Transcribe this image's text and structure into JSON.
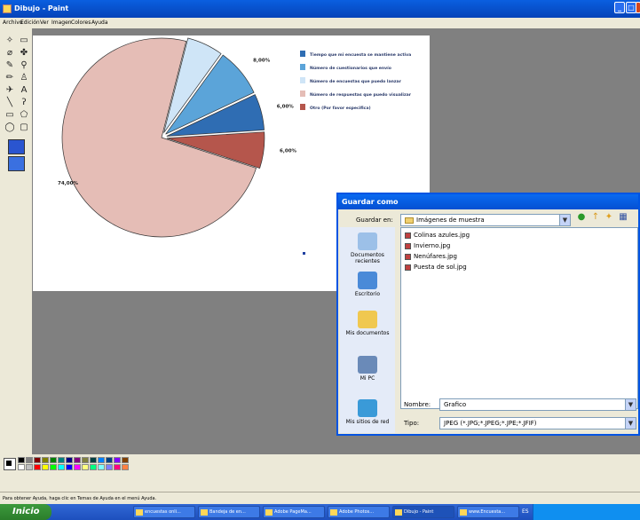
{
  "window": {
    "title": "Dibujo - Paint",
    "min": "_",
    "max": "□",
    "close": "x"
  },
  "menu": [
    "Archivo",
    "Edición",
    "Ver",
    "Imagen",
    "Colores",
    "Ayuda"
  ],
  "chart_data": {
    "type": "pie",
    "title": "",
    "categories": [
      "Tiempo que mi encuesta se mantiene activa",
      "Número de cuestionarios que envío",
      "Número de encuestas que puedo lanzar",
      "Número de respuestas que puedo visualizar",
      "Otro (Por favor especifica)"
    ],
    "values": [
      6.0,
      8.0,
      6.0,
      74.0,
      6.0
    ],
    "labels": [
      "6,00%",
      "8,00%",
      "6,00%",
      "74,00%",
      "6,00%"
    ],
    "colors": [
      "#2f6db3",
      "#5ba4d9",
      "#cfe5f7",
      "#e5bdb6",
      "#b5564c"
    ],
    "legend_position": "right"
  },
  "dialog": {
    "title": "Guardar como",
    "save_in_label": "Guardar en:",
    "save_in_value": "Imágenes de muestra",
    "places": [
      "Documentos recientes",
      "Escritorio",
      "Mis documentos",
      "Mi PC",
      "Mis sitios de red"
    ],
    "files": [
      "Colinas azules.jpg",
      "Invierno.jpg",
      "Nenúfares.jpg",
      "Puesta de sol.jpg"
    ],
    "name_label": "Nombre:",
    "name_value": "Grafico",
    "type_label": "Tipo:",
    "type_value": "JPEG (*.JPG;*.JPEG;*.JPE;*.JFIF)"
  },
  "status_text": "Para obtener Ayuda, haga clic en Temas de Ayuda en el menú Ayuda.",
  "taskbar": {
    "start": "Inicio",
    "items": [
      "encuestas onli...",
      "Bandeja de en...",
      "Adobe PageMa...",
      "Adobe Photos...",
      "Dibujo - Paint",
      "www.Encuesta..."
    ],
    "lang": "ES"
  },
  "palette_colors": [
    "#000000",
    "#808080",
    "#800000",
    "#808000",
    "#008000",
    "#008080",
    "#000080",
    "#800080",
    "#808040",
    "#004040",
    "#0080ff",
    "#004080",
    "#8000ff",
    "#804000",
    "#ffffff",
    "#c0c0c0",
    "#ff0000",
    "#ffff00",
    "#00ff00",
    "#00ffff",
    "#0000ff",
    "#ff00ff",
    "#ffff80",
    "#00ff80",
    "#80ffff",
    "#8080ff",
    "#ff0080",
    "#ff8040"
  ]
}
